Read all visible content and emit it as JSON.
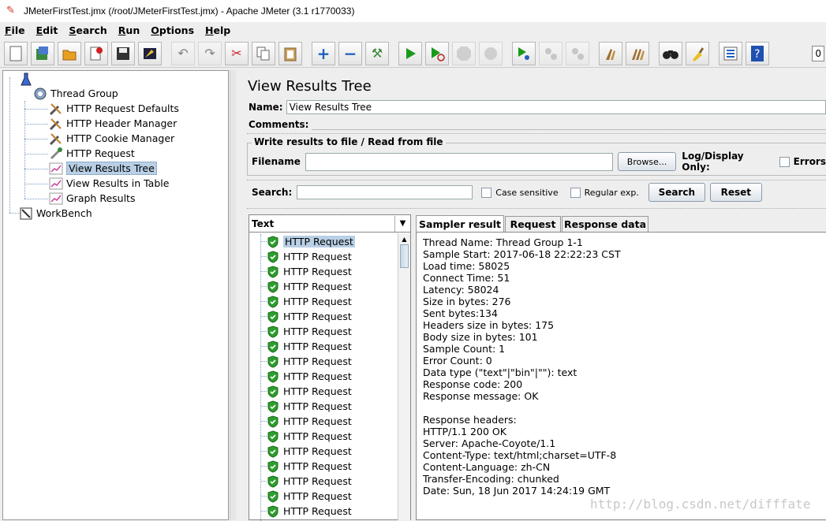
{
  "window": {
    "title": "JMeterFirstTest.jmx (/root/JMeterFirstTest.jmx) - Apache JMeter (3.1 r1770033)"
  },
  "menu": [
    {
      "key": "F",
      "rest": "ile"
    },
    {
      "key": "E",
      "rest": "dit"
    },
    {
      "key": "S",
      "rest": "earch"
    },
    {
      "key": "R",
      "rest": "un"
    },
    {
      "key": "O",
      "rest": "ptions"
    },
    {
      "key": "H",
      "rest": "elp"
    }
  ],
  "toolbar_overflow_label": "0",
  "tree": {
    "thread_group": "Thread Group",
    "items": [
      "HTTP Request Defaults",
      "HTTP Header Manager",
      "HTTP Cookie Manager",
      "HTTP Request",
      "View Results Tree",
      "View Results in Table",
      "Graph Results"
    ],
    "workbench": "WorkBench"
  },
  "panel": {
    "title": "View Results Tree",
    "name_label": "Name:",
    "name_value": "View Results Tree",
    "comments_label": "Comments:",
    "fieldset_legend": "Write results to file / Read from file",
    "filename_label": "Filename",
    "browse_label": "Browse...",
    "log_display_label": "Log/Display Only:",
    "errors_label": "Errors",
    "search_label": "Search:",
    "case_sensitive_label": "Case sensitive",
    "regex_label": "Regular exp.",
    "search_button": "Search",
    "reset_button": "Reset"
  },
  "results": {
    "renderer": "Text",
    "sample_label": "HTTP Request"
  },
  "tabs": [
    "Sampler result",
    "Request",
    "Response data"
  ],
  "detail": [
    "Thread Name: Thread Group 1-1",
    "Sample Start: 2017-06-18 22:22:23 CST",
    "Load time: 58025",
    "Connect Time: 51",
    "Latency: 58024",
    "Size in bytes: 276",
    "Sent bytes:134",
    "Headers size in bytes: 175",
    "Body size in bytes: 101",
    "Sample Count: 1",
    "Error Count: 0",
    "Data type (\"text\"|\"bin\"|\"\"): text",
    "Response code: 200",
    "Response message: OK",
    "",
    "Response headers:",
    "HTTP/1.1 200 OK",
    "Server: Apache-Coyote/1.1",
    "Content-Type: text/html;charset=UTF-8",
    "Content-Language: zh-CN",
    "Transfer-Encoding: chunked",
    "Date: Sun, 18 Jun 2017 14:24:19 GMT"
  ],
  "watermark": "http://blog.csdn.net/difffate",
  "colors": {
    "selection": "#b8cfe5",
    "success_shield": "#2e9e2e",
    "play": "#1a9a1a"
  }
}
